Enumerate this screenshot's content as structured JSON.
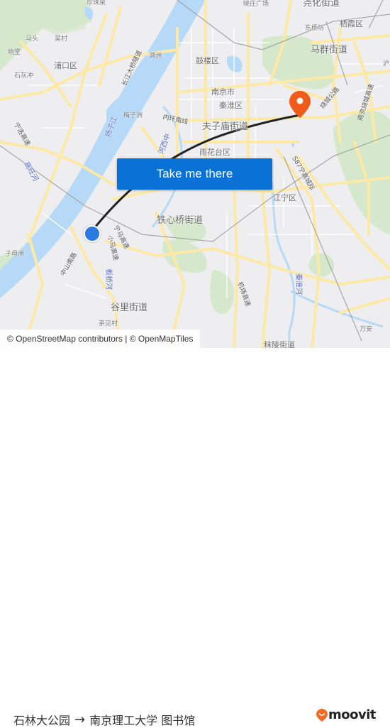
{
  "map": {
    "labels": {
      "zhenzhuquan": "珍珠泉",
      "xiaozhuang": "晓庄广场",
      "yaohua": "尧化街道",
      "matou": "马头",
      "wucun": "吴村",
      "dongyangfang": "东杨坊",
      "qixia": "栖霞区",
      "xiangtang": "响堂",
      "pukou": "浦口区",
      "qianzhou": "潜洲",
      "gulou": "鼓楼区",
      "maqun": "马群街道",
      "shihuichong": "石灰冲",
      "nanjing": "南京市",
      "qinhuai": "秦淮区",
      "meizizhou": "梅子洲",
      "neihuan": "内环南线",
      "fuzimiao": "夫子庙街道",
      "yuhuatai": "雨花台区",
      "jiangning": "江宁区",
      "tiexinqiao": "铁心桥街道",
      "zimuzhou": "子母洲",
      "guli": "谷里街道",
      "qinjiancun": "亲见村",
      "wanan": "万安",
      "luling": "秣陵街道",
      "hu": "沪"
    },
    "water_labels": {
      "yangtze": "扬子江",
      "gaotianhe": "高旺河",
      "hexizhong": "河西中",
      "banqiaohe": "板桥河",
      "qinhuaihe": "秦淮河"
    },
    "road_labels": {
      "changjiang_tunnel": "长江大桥隧道",
      "ningluo": "宁洛高速",
      "s87": "S87宁高城际",
      "raocheng": "绕城公路",
      "nanjing_raocheng": "南京绕城高速",
      "jichang": "机场高速",
      "yinghua": "宁马高速",
      "xiaoshan": "小马高速",
      "xiamen": "中山南路"
    },
    "attribution": "© OpenStreetMap contributors | © OpenMapTiles",
    "cta_label": "Take me there",
    "colors": {
      "land": "#eeeef0",
      "water": "#b5d9f7",
      "park": "#d5e8cc",
      "road": "#fde9a6",
      "route": "#222222",
      "origin": "#2a7ae2",
      "destination": "#f05a1a",
      "button": "#0a72d6"
    }
  },
  "footer": {
    "origin": "石林大公园",
    "arrow": "→",
    "destination": "南京理工大学 图书馆",
    "brand": "moovit",
    "brand_color": "#f26b21"
  }
}
